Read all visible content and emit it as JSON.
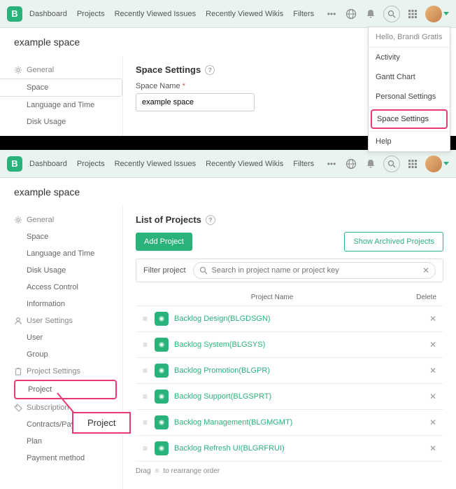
{
  "logo_letter": "B",
  "nav": [
    "Dashboard",
    "Projects",
    "Recently Viewed Issues",
    "Recently Viewed Wikis",
    "Filters"
  ],
  "dots": "•••",
  "space_title": "example space",
  "top": {
    "sidebar": {
      "general": "General",
      "items": [
        "Space",
        "Language and Time",
        "Disk Usage"
      ]
    },
    "section_title": "Space Settings",
    "field_label": "Space Name",
    "field_value": "example space",
    "dropdown": {
      "greeting": "Hello, Brandi Gratis",
      "items": [
        "Activity",
        "Gantt Chart",
        "Personal Settings"
      ],
      "highlight": "Space Settings",
      "after": [
        "Help"
      ]
    }
  },
  "bottom": {
    "sidebar": {
      "general": {
        "label": "General",
        "items": [
          "Space",
          "Language and Time",
          "Disk Usage",
          "Access Control",
          "Information"
        ]
      },
      "user_settings": {
        "label": "User Settings",
        "items": [
          "User",
          "Group"
        ]
      },
      "project_settings": {
        "label": "Project Settings",
        "items": [
          "Project"
        ]
      },
      "subscription": {
        "label": "Subscription",
        "items": [
          "Contracts/Paym",
          "Plan",
          "Payment method"
        ]
      }
    },
    "section_title": "List of Projects",
    "add_btn": "Add Project",
    "archived_btn": "Show Archived Projects",
    "filter_label": "Filter project",
    "search_placeholder": "Search in project name or project key",
    "th_name": "Project Name",
    "th_del": "Delete",
    "projects": [
      "Backlog Design(BLGDSGN)",
      "Backlog System(BLGSYS)",
      "Backlog Promotion(BLGPR)",
      "Backlog Support(BLGSPRT)",
      "Backlog Management(BLGMGMT)",
      "Backlog Refresh UI(BLGRFRUI)"
    ],
    "drag_hint_pre": "Drag",
    "drag_hint_post": "to rearrange order",
    "callout": "Project"
  }
}
